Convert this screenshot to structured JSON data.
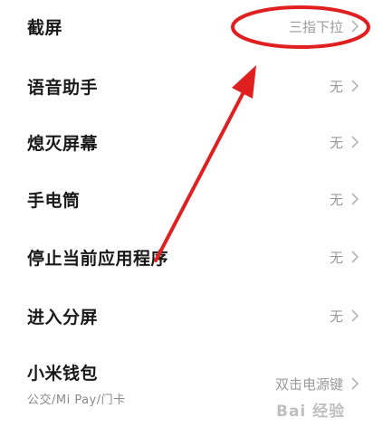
{
  "settings": {
    "items": [
      {
        "label": "截屏",
        "value": "三指下拉"
      },
      {
        "label": "语音助手",
        "value": "无"
      },
      {
        "label": "熄灭屏幕",
        "value": "无"
      },
      {
        "label": "手电筒",
        "value": "无"
      },
      {
        "label": "停止当前应用程序",
        "value": "无"
      },
      {
        "label": "进入分屏",
        "value": "无"
      },
      {
        "label": "小米钱包",
        "sublabel": "公交/Mi Pay/门卡",
        "value": "双击电源键"
      }
    ]
  },
  "annotation": {
    "color": "#e02020"
  },
  "watermark": "Bai 经验"
}
